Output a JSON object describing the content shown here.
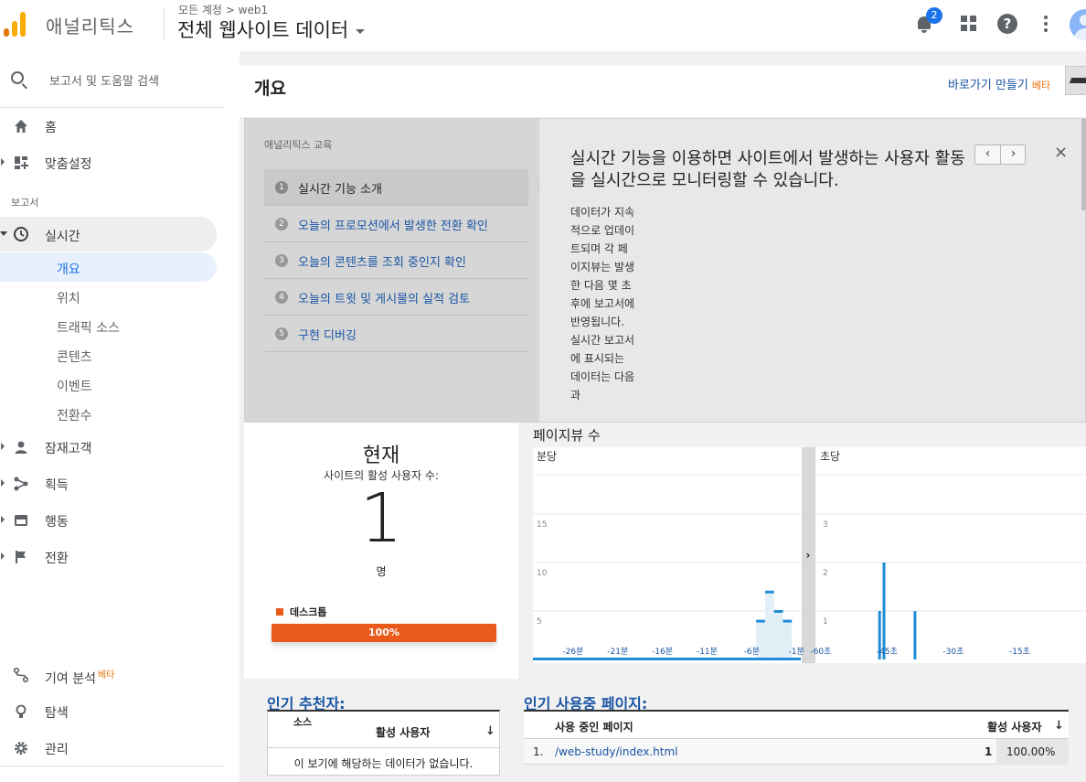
{
  "header": {
    "app_name": "애널리틱스",
    "breadcrumb": "모든 계정 > web1",
    "property": "전체 웹사이트 데이터",
    "notification_count": "2",
    "help_label": "?"
  },
  "sidebar": {
    "search_label": "보고서 및 도움말 검색",
    "home": "홈",
    "custom": "맞춤설정",
    "section_reports": "보고서",
    "realtime": "실시간",
    "realtime_items": [
      "개요",
      "위치",
      "트래픽 소스",
      "콘텐츠",
      "이벤트",
      "전환수"
    ],
    "audience": "잠재고객",
    "acquisition": "획득",
    "behavior": "행동",
    "conversions": "전환",
    "attribution": "기여 분석",
    "attribution_beta": "베타",
    "discover": "탐색",
    "admin": "관리"
  },
  "main": {
    "title": "개요",
    "shortcut": "바로가기 만들기",
    "shortcut_beta": "베타"
  },
  "education": {
    "title": "애널리틱스 교육",
    "steps": [
      {
        "num": "1",
        "label": "실시간 기능 소개"
      },
      {
        "num": "2",
        "label": "오늘의 프로모션에서 발생한 전환 확인"
      },
      {
        "num": "3",
        "label": "오늘의 콘텐츠를 조회 중인지 확인"
      },
      {
        "num": "4",
        "label": "오늘의 트윗 및 게시물의 실적 검토"
      },
      {
        "num": "5",
        "label": "구현 디버깅"
      }
    ],
    "heading": "실시간 기능을 이용하면 사이트에서 발생하는 사용자 활동을 실시간으로 모니터링할 수 있습니다.",
    "body": "데이터가 지속적으로 업데이트되며 각 페이지뷰는 발생한 다음 몇 초 후에 보고서에 반영됩니다. 실시간 보고서에 표시되는 데이터는 다음과",
    "prev": "‹",
    "next": "›",
    "close": "×"
  },
  "now": {
    "title": "현재",
    "subtitle": "사이트의 활성 사용자 수:",
    "count": "1",
    "unit": "명",
    "device_label": "데스크톱",
    "device_percent": "100%",
    "device_color": "#e8591a"
  },
  "pageviews": {
    "title": "페이지뷰 수",
    "per_minute_label": "분당",
    "per_second_label": "초당",
    "expand_icon": "chevron-right"
  },
  "chart_data": [
    {
      "type": "bar",
      "title": "분당",
      "x_tick_labels": [
        "-26분",
        "-21분",
        "-16분",
        "-11분",
        "-6분",
        "-1분"
      ],
      "y_ticks": [
        5,
        10,
        15
      ],
      "ylim": [
        0,
        20
      ],
      "x": [
        -30,
        -29,
        -28,
        -27,
        -26,
        -25,
        -24,
        -23,
        -22,
        -21,
        -20,
        -19,
        -18,
        -17,
        -16,
        -15,
        -14,
        -13,
        -12,
        -11,
        -10,
        -9,
        -8,
        -7,
        -6,
        -5,
        -4,
        -3,
        -2,
        -1
      ],
      "values": [
        0,
        0,
        0,
        0,
        0,
        0,
        0,
        0,
        0,
        0,
        0,
        0,
        0,
        0,
        0,
        0,
        0,
        0,
        0,
        0,
        0,
        0,
        0,
        0,
        0,
        4,
        7,
        5,
        4,
        0
      ],
      "color": "#1f8dd6"
    },
    {
      "type": "bar",
      "title": "초당",
      "x_tick_labels": [
        "-60초",
        "-45초",
        "-30초",
        "-15초"
      ],
      "y_ticks": [
        1,
        2,
        3
      ],
      "ylim": [
        0,
        4
      ],
      "x": [
        -47,
        -46,
        -39
      ],
      "values": [
        1,
        2,
        1
      ],
      "color": "#1f8dd6"
    }
  ],
  "referrers": {
    "title": "인기 추천자:",
    "col_source": "소스",
    "col_users": "활성 사용자",
    "empty": "이 보기에 해당하는 데이터가 없습니다."
  },
  "pages": {
    "title": "인기 사용중 페이지:",
    "col_page": "사용 중인 페이지",
    "col_users": "활성 사용자",
    "rows": [
      {
        "rank": "1.",
        "page": "/web-study/index.html",
        "users": "1",
        "share": "100.00%"
      }
    ]
  }
}
